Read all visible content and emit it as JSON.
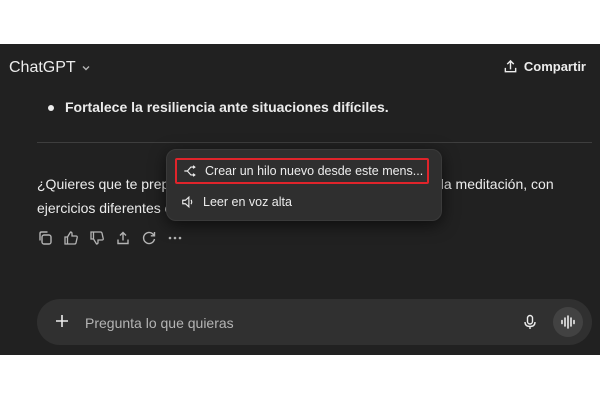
{
  "header": {
    "model_name": "ChatGPT",
    "share_label": "Compartir"
  },
  "conversation": {
    "bullet": "Fortalece la resiliencia ante situaciones difíciles.",
    "question_line1": "¿Quieres que te prep",
    "question_line1_tail": "en la meditación, con",
    "question_line2": "ejercicios diferentes c"
  },
  "message_actions": [
    "copy-icon",
    "thumbs-up-icon",
    "thumbs-down-icon",
    "share-icon",
    "regenerate-icon",
    "more-icon"
  ],
  "context_menu": {
    "branch_label": "Crear un hilo nuevo desde este mens...",
    "read_aloud_label": "Leer en voz alta",
    "highlight_color": "#e0242b"
  },
  "composer": {
    "placeholder": "Pregunta lo que quieras"
  },
  "colors": {
    "background": "#212121",
    "surface": "#303030",
    "text": "#ececec"
  }
}
